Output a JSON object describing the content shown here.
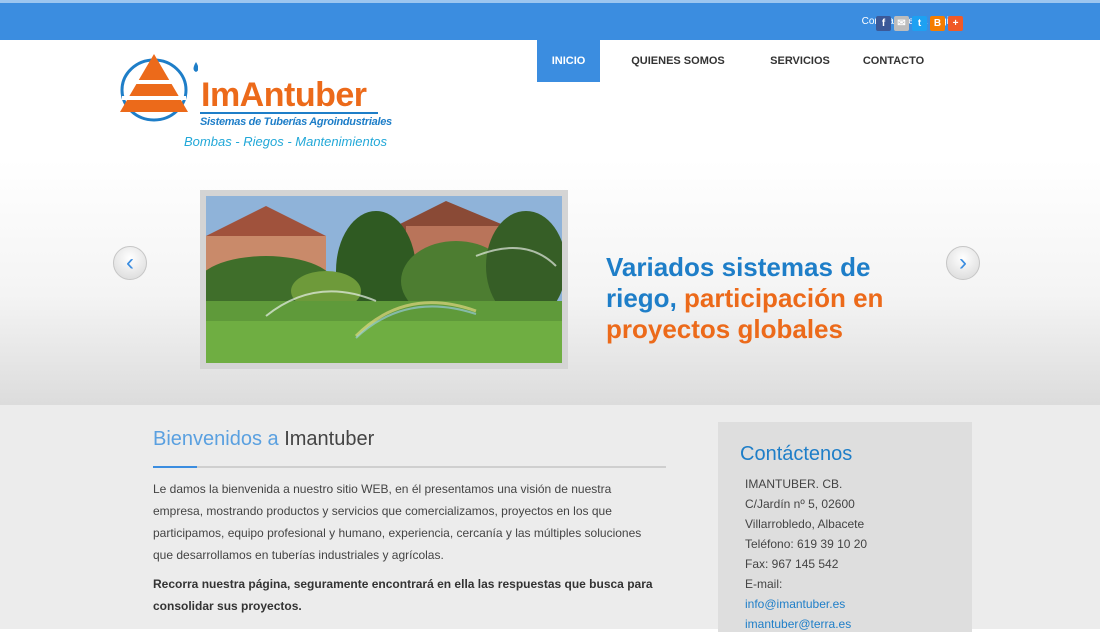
{
  "topbar": {
    "share_label": "Comparte esta página",
    "share_icons": [
      {
        "icon": "facebook-icon",
        "glyph": "f",
        "color": "#3b5998"
      },
      {
        "icon": "email-icon",
        "glyph": "✉",
        "color": "#bdbdbd"
      },
      {
        "icon": "twitter-icon",
        "glyph": "t",
        "color": "#1da1f2"
      },
      {
        "icon": "blogger-icon",
        "glyph": "B",
        "color": "#f57d00"
      },
      {
        "icon": "more-plus-icon",
        "glyph": "+",
        "color": "#f05a28"
      }
    ]
  },
  "logo": {
    "brand": "ImAntuber",
    "tagline": "Sistemas de Tuberías Agroindustriales",
    "services": "Bombas - Riegos - Mantenimientos"
  },
  "nav": {
    "items": [
      {
        "label": "INICIO",
        "active": true
      },
      {
        "label": "QUIENES SOMOS",
        "active": false
      },
      {
        "label": "SERVICIOS",
        "active": false
      },
      {
        "label": "CONTACTO",
        "active": false
      }
    ]
  },
  "hero": {
    "line_blue": "Variados sistemas de riego,",
    "line_orange": "participación en proyectos globales"
  },
  "welcome": {
    "title_prefix": "Bienvenidos a",
    "title_name": "Imantuber",
    "paragraph": "Le damos la bienvenida a nuestro sitio WEB, en él presentamos una visión de nuestra empresa, mostrando productos y servicios que comercializamos, proyectos en los que participamos, equipo profesional y humano, experiencia, cercanía y las múltiples soluciones que desarrollamos en tuberías industriales y agrícolas.",
    "bold_paragraph": "Recorra nuestra página, seguramente encontrará en ella las respuestas que busca para consolidar sus proyectos."
  },
  "contact": {
    "title": "Contáctenos",
    "company": "IMANTUBER. CB.",
    "address": "C/Jardín nº 5, 02600",
    "city": "Villarrobledo, Albacete",
    "phone": "Teléfono: 619 39 10 20",
    "fax": "Fax: 967 145 542",
    "email_label": "E-mail:",
    "email_1": "info@imantuber.es",
    "email_2": "imantuber@terra.es"
  },
  "colors": {
    "brand_blue": "#3b8de0",
    "brand_orange": "#ec6a1a"
  }
}
